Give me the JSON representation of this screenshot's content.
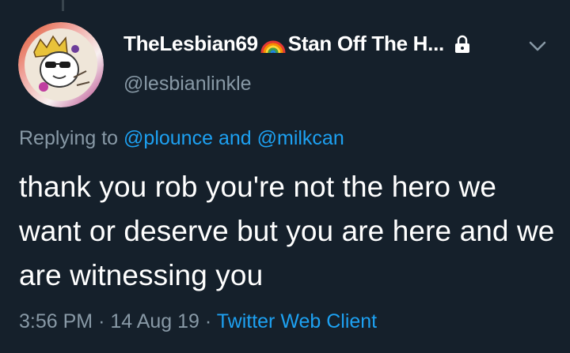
{
  "tweet": {
    "display_name": "TheLesbian69",
    "display_name_suffix": "Stan Off The H...",
    "handle": "@lesbianlinkle",
    "replying_to_label": "Replying to",
    "mention_1": "@plounce",
    "replying_and": "and",
    "mention_2": "@milkcan",
    "text": "thank you rob you're not the hero we want or deserve but you are here and we are witnessing you",
    "time": "3:56 PM",
    "separator": "·",
    "date": "14 Aug 19",
    "source": "Twitter Web Client"
  },
  "icons": {
    "name_emoji": "rainbow-icon",
    "protected": "lock-icon",
    "menu": "chevron-down-icon"
  },
  "colors": {
    "background": "#15202b",
    "primary_text": "#ffffff",
    "secondary_text": "#8899a6",
    "link": "#1da1f2"
  }
}
